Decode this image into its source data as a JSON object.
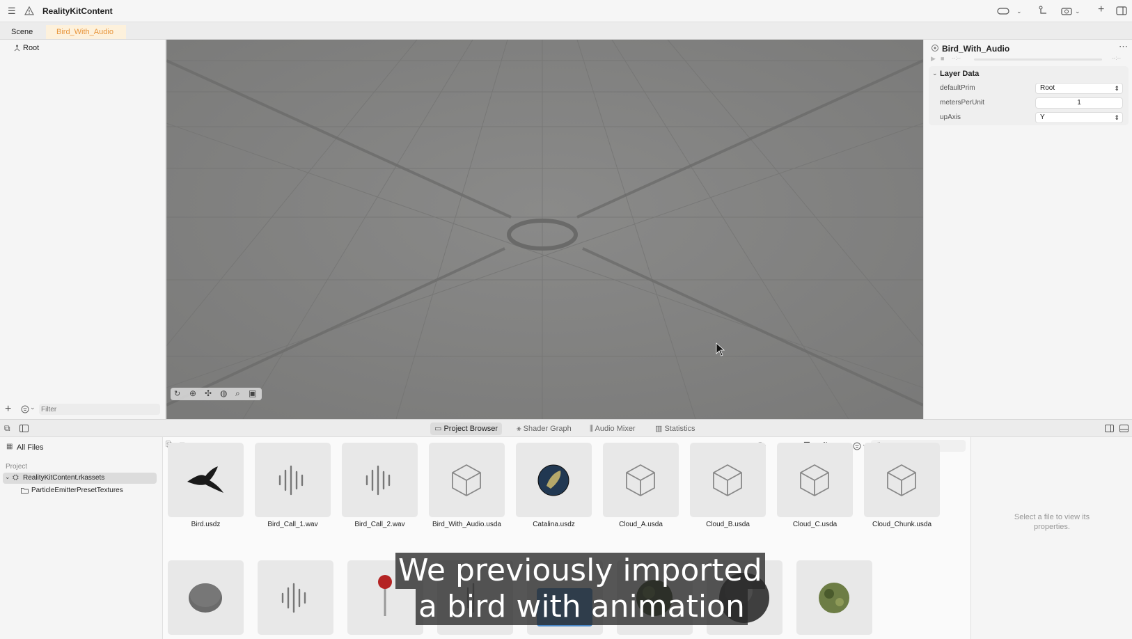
{
  "titlebar": {
    "title": "RealityKitContent"
  },
  "tabs": [
    {
      "label": "Scene"
    },
    {
      "label": "Bird_With_Audio"
    }
  ],
  "outline": {
    "root_label": "Root",
    "filter_placeholder": "Filter"
  },
  "inspector": {
    "title": "Bird_With_Audio",
    "time_placeholder": "--:--",
    "section": "Layer Data",
    "rows": [
      {
        "label": "defaultPrim",
        "value": "Root"
      },
      {
        "label": "metersPerUnit",
        "value": "1"
      },
      {
        "label": "upAxis",
        "value": "Y"
      }
    ]
  },
  "bottom_tabs": [
    {
      "label": "Project Browser"
    },
    {
      "label": "Shader Graph"
    },
    {
      "label": "Audio Mixer"
    },
    {
      "label": "Statistics"
    }
  ],
  "files_sidebar": {
    "all_files": "All Files",
    "section": "Project",
    "items": [
      {
        "label": "RealityKitContent.rkassets"
      },
      {
        "label": "ParticleEmitterPresetTextures"
      }
    ]
  },
  "browser": {
    "filter_placeholder": "Filter",
    "assets_row1": [
      {
        "name": "Bird.usdz",
        "icon": "bird-icon"
      },
      {
        "name": "Bird_Call_1.wav",
        "icon": "waveform-icon"
      },
      {
        "name": "Bird_Call_2.wav",
        "icon": "waveform-icon"
      },
      {
        "name": "Bird_With_Audio.usda",
        "icon": "cube-icon"
      },
      {
        "name": "Catalina.usdz",
        "icon": "island-globe-icon"
      },
      {
        "name": "Cloud_A.usda",
        "icon": "cube-icon"
      },
      {
        "name": "Cloud_B.usda",
        "icon": "cube-icon"
      },
      {
        "name": "Cloud_C.usda",
        "icon": "cube-icon"
      },
      {
        "name": "Cloud_Chunk.usda",
        "icon": "cube-icon"
      }
    ]
  },
  "properties_pane": {
    "empty_text": "Select a file to view its properties."
  },
  "caption": {
    "line1": "We previously imported",
    "line2": "a bird with animation"
  }
}
